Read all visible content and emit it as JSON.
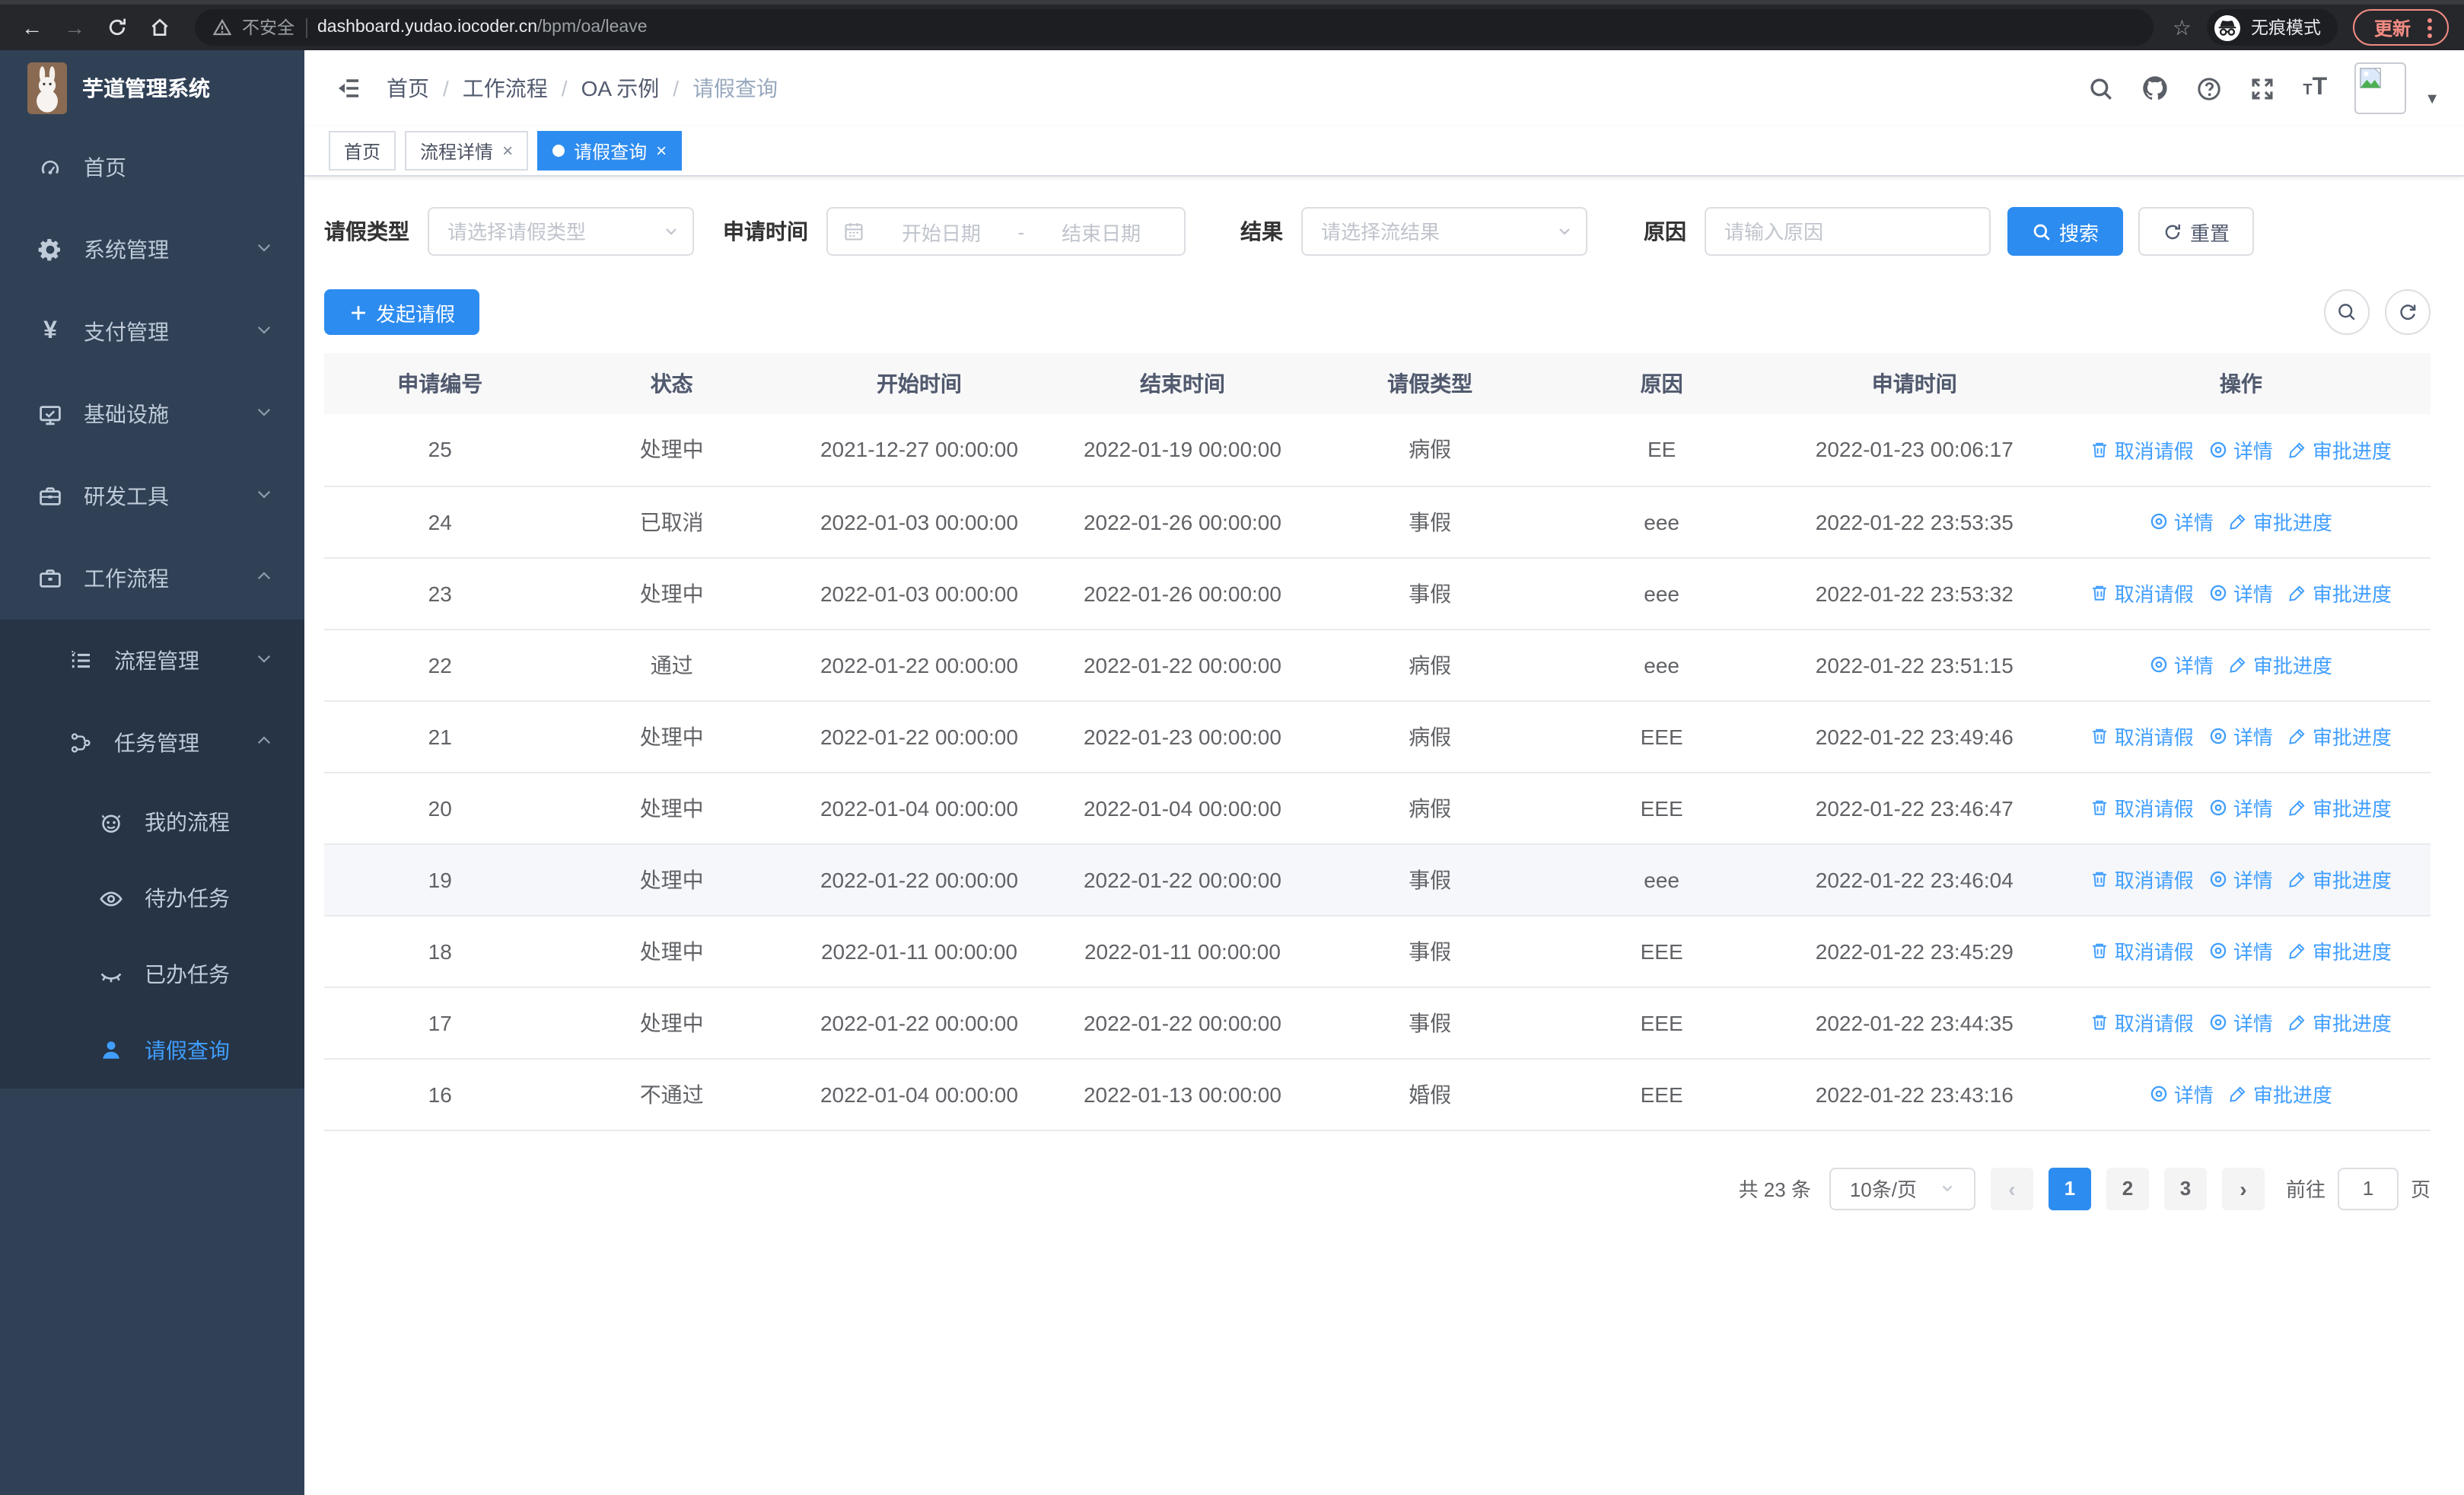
{
  "colors": {
    "accent": "#2d8cf0",
    "link": "#409eff",
    "sidebar_bg": "#304156",
    "submenu_bg": "#263445",
    "update_accent": "#f28b82"
  },
  "browser": {
    "security_label": "不安全",
    "url_host": "dashboard.yudao.iocoder.cn",
    "url_path": "/bpm/oa/leave",
    "incognito_label": "无痕模式",
    "update_label": "更新"
  },
  "sidebar": {
    "logo_title": "芋道管理系统",
    "items": [
      {
        "key": "home",
        "label": "首页",
        "level": 1,
        "icon": "dashboard"
      },
      {
        "key": "system",
        "label": "系统管理",
        "level": 1,
        "icon": "gear",
        "chevron": "down"
      },
      {
        "key": "payment",
        "label": "支付管理",
        "level": 1,
        "icon": "yen",
        "chevron": "down"
      },
      {
        "key": "infra",
        "label": "基础设施",
        "level": 1,
        "icon": "monitor",
        "chevron": "down"
      },
      {
        "key": "devtools",
        "label": "研发工具",
        "level": 1,
        "icon": "toolbox",
        "chevron": "down"
      },
      {
        "key": "workflow",
        "label": "工作流程",
        "level": 1,
        "icon": "briefcase",
        "chevron": "up",
        "children": [
          {
            "key": "process-mgmt",
            "label": "流程管理",
            "level": 2,
            "icon": "list",
            "chevron": "down"
          },
          {
            "key": "task-mgmt",
            "label": "任务管理",
            "level": 2,
            "icon": "tree",
            "chevron": "up",
            "children": [
              {
                "key": "my-process",
                "label": "我的流程",
                "level": 3,
                "icon": "face"
              },
              {
                "key": "todo-tasks",
                "label": "待办任务",
                "level": 3,
                "icon": "eye"
              },
              {
                "key": "done-tasks",
                "label": "已办任务",
                "level": 3,
                "icon": "eye-closed"
              },
              {
                "key": "leave-query",
                "label": "请假查询",
                "level": 3,
                "icon": "user",
                "active": true
              }
            ]
          }
        ]
      }
    ]
  },
  "breadcrumb": {
    "items": [
      "首页",
      "工作流程",
      "OA 示例",
      "请假查询"
    ]
  },
  "tabs": [
    {
      "label": "首页",
      "active": false,
      "closable": false
    },
    {
      "label": "流程详情",
      "active": false,
      "closable": true
    },
    {
      "label": "请假查询",
      "active": true,
      "closable": true
    }
  ],
  "filters": {
    "leave_type_label": "请假类型",
    "leave_type_placeholder": "请选择请假类型",
    "apply_time_label": "申请时间",
    "date_start_placeholder": "开始日期",
    "date_separator": "-",
    "date_end_placeholder": "结束日期",
    "result_label": "结果",
    "result_placeholder": "请选择流结果",
    "reason_label": "原因",
    "reason_placeholder": "请输入原因",
    "search_label": "搜索",
    "reset_label": "重置"
  },
  "toolbar": {
    "create_label": "发起请假"
  },
  "table": {
    "columns": [
      "申请编号",
      "状态",
      "开始时间",
      "结束时间",
      "请假类型",
      "原因",
      "申请时间",
      "操作"
    ],
    "col_widths": [
      "11%",
      "11%",
      "12.5%",
      "12.5%",
      "11%",
      "11%",
      "13%",
      "18%"
    ],
    "actions": {
      "cancel": "取消请假",
      "detail": "详情",
      "progress": "审批进度"
    },
    "rows": [
      {
        "id": "25",
        "status": "处理中",
        "start": "2021-12-27 00:00:00",
        "end": "2022-01-19 00:00:00",
        "type": "病假",
        "reason": "EE",
        "applied": "2022-01-23 00:06:17",
        "cancelable": true,
        "highlight": false
      },
      {
        "id": "24",
        "status": "已取消",
        "start": "2022-01-03 00:00:00",
        "end": "2022-01-26 00:00:00",
        "type": "事假",
        "reason": "eee",
        "applied": "2022-01-22 23:53:35",
        "cancelable": false,
        "highlight": false
      },
      {
        "id": "23",
        "status": "处理中",
        "start": "2022-01-03 00:00:00",
        "end": "2022-01-26 00:00:00",
        "type": "事假",
        "reason": "eee",
        "applied": "2022-01-22 23:53:32",
        "cancelable": true,
        "highlight": false
      },
      {
        "id": "22",
        "status": "通过",
        "start": "2022-01-22 00:00:00",
        "end": "2022-01-22 00:00:00",
        "type": "病假",
        "reason": "eee",
        "applied": "2022-01-22 23:51:15",
        "cancelable": false,
        "highlight": false
      },
      {
        "id": "21",
        "status": "处理中",
        "start": "2022-01-22 00:00:00",
        "end": "2022-01-23 00:00:00",
        "type": "病假",
        "reason": "EEE",
        "applied": "2022-01-22 23:49:46",
        "cancelable": true,
        "highlight": false
      },
      {
        "id": "20",
        "status": "处理中",
        "start": "2022-01-04 00:00:00",
        "end": "2022-01-04 00:00:00",
        "type": "病假",
        "reason": "EEE",
        "applied": "2022-01-22 23:46:47",
        "cancelable": true,
        "highlight": false
      },
      {
        "id": "19",
        "status": "处理中",
        "start": "2022-01-22 00:00:00",
        "end": "2022-01-22 00:00:00",
        "type": "事假",
        "reason": "eee",
        "applied": "2022-01-22 23:46:04",
        "cancelable": true,
        "highlight": true
      },
      {
        "id": "18",
        "status": "处理中",
        "start": "2022-01-11 00:00:00",
        "end": "2022-01-11 00:00:00",
        "type": "事假",
        "reason": "EEE",
        "applied": "2022-01-22 23:45:29",
        "cancelable": true,
        "highlight": false
      },
      {
        "id": "17",
        "status": "处理中",
        "start": "2022-01-22 00:00:00",
        "end": "2022-01-22 00:00:00",
        "type": "事假",
        "reason": "EEE",
        "applied": "2022-01-22 23:44:35",
        "cancelable": true,
        "highlight": false
      },
      {
        "id": "16",
        "status": "不通过",
        "start": "2022-01-04 00:00:00",
        "end": "2022-01-13 00:00:00",
        "type": "婚假",
        "reason": "EEE",
        "applied": "2022-01-22 23:43:16",
        "cancelable": false,
        "highlight": false
      }
    ]
  },
  "pagination": {
    "total_label": "共 23 条",
    "page_size": "10条/页",
    "pages": [
      "1",
      "2",
      "3"
    ],
    "active_page": "1",
    "goto_label": "前往",
    "goto_value": "1",
    "goto_suffix": "页"
  }
}
